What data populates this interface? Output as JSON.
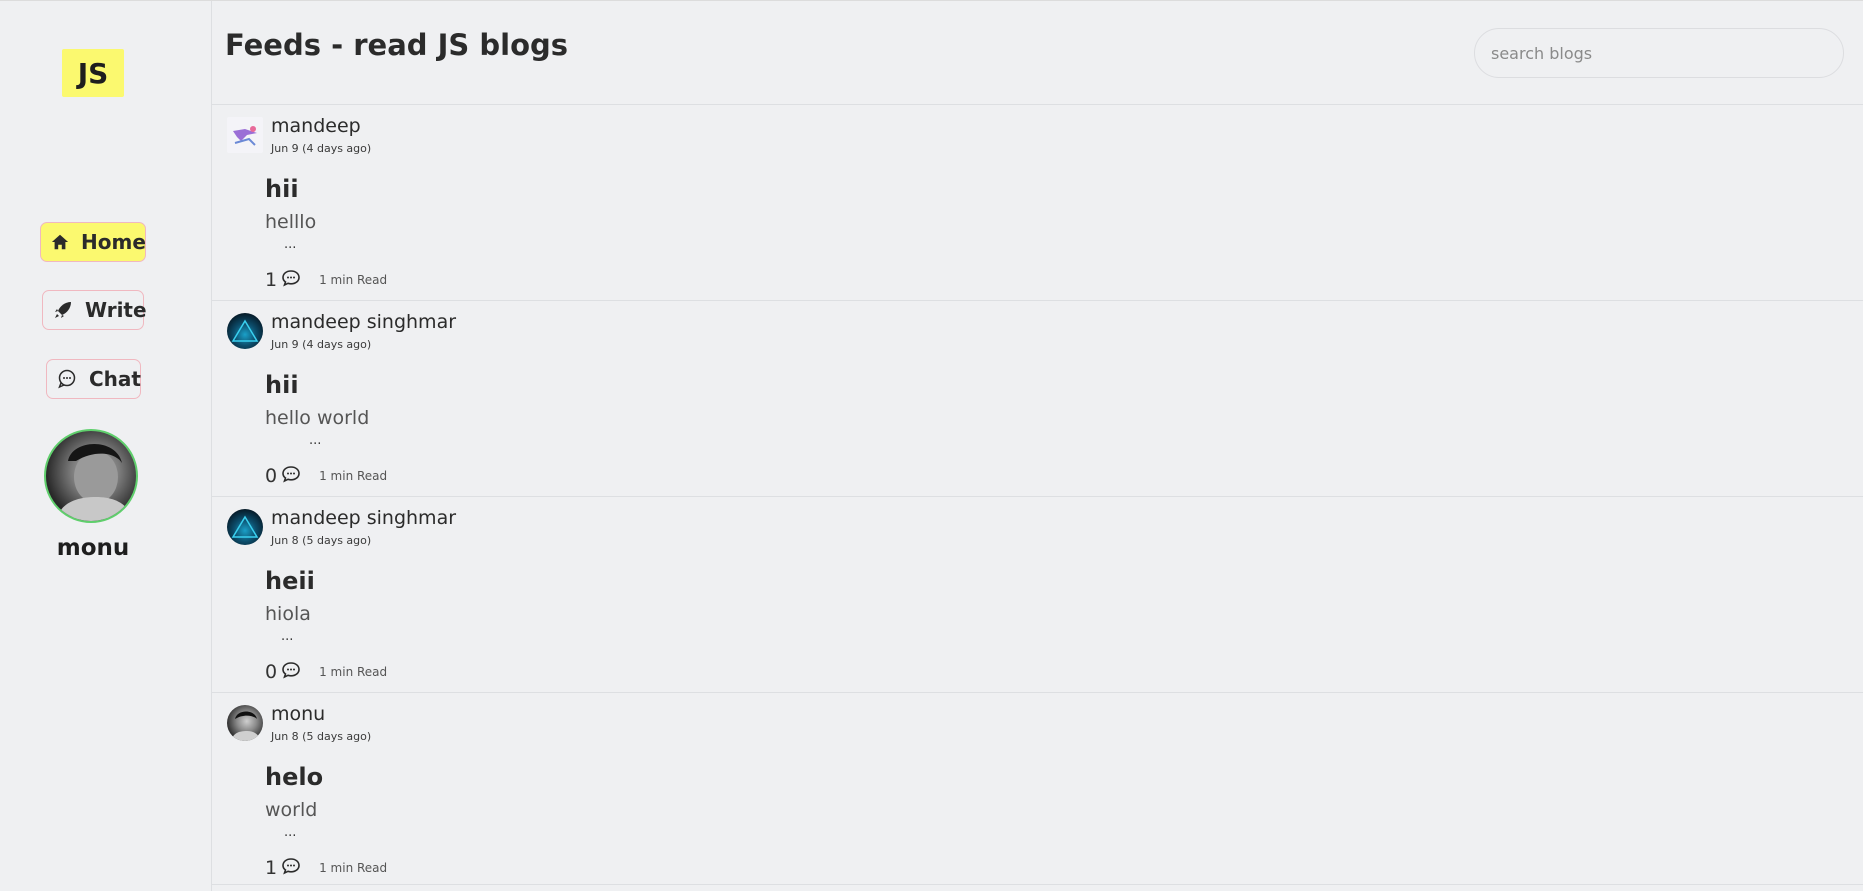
{
  "sidebar": {
    "logo": "JS",
    "nav": [
      {
        "label": "Home",
        "icon": "home-icon",
        "active": true
      },
      {
        "label": "Write",
        "icon": "rocket-icon",
        "active": false
      },
      {
        "label": "Chat",
        "icon": "chat-bubble-icon",
        "active": false
      }
    ],
    "profile": {
      "name": "monu"
    }
  },
  "header": {
    "title": "Feeds - read JS blogs",
    "search_placeholder": "search blogs"
  },
  "posts": [
    {
      "author": "mandeep",
      "date": "Jun 9 (4 days ago)",
      "title": "hii",
      "excerpt": "helllo",
      "ellipsis": "...",
      "comments": "1",
      "read_time": "1 min Read"
    },
    {
      "author": "mandeep singhmar",
      "date": "Jun 9 (4 days ago)",
      "title": "hii",
      "excerpt": "hello world",
      "ellipsis": "...",
      "comments": "0",
      "read_time": "1 min Read"
    },
    {
      "author": "mandeep singhmar",
      "date": "Jun 8 (5 days ago)",
      "title": "heii",
      "excerpt": "hiola",
      "ellipsis": "...",
      "comments": "0",
      "read_time": "1 min Read"
    },
    {
      "author": "monu",
      "date": "Jun 8 (5 days ago)",
      "title": "helo",
      "excerpt": "world",
      "ellipsis": "...",
      "comments": "1",
      "read_time": "1 min Read"
    }
  ],
  "colors": {
    "accent": "#fbf96f",
    "background": "#eff0f2",
    "nav_border": "#f0b8c0",
    "profile_ring": "#5fcf6c"
  }
}
